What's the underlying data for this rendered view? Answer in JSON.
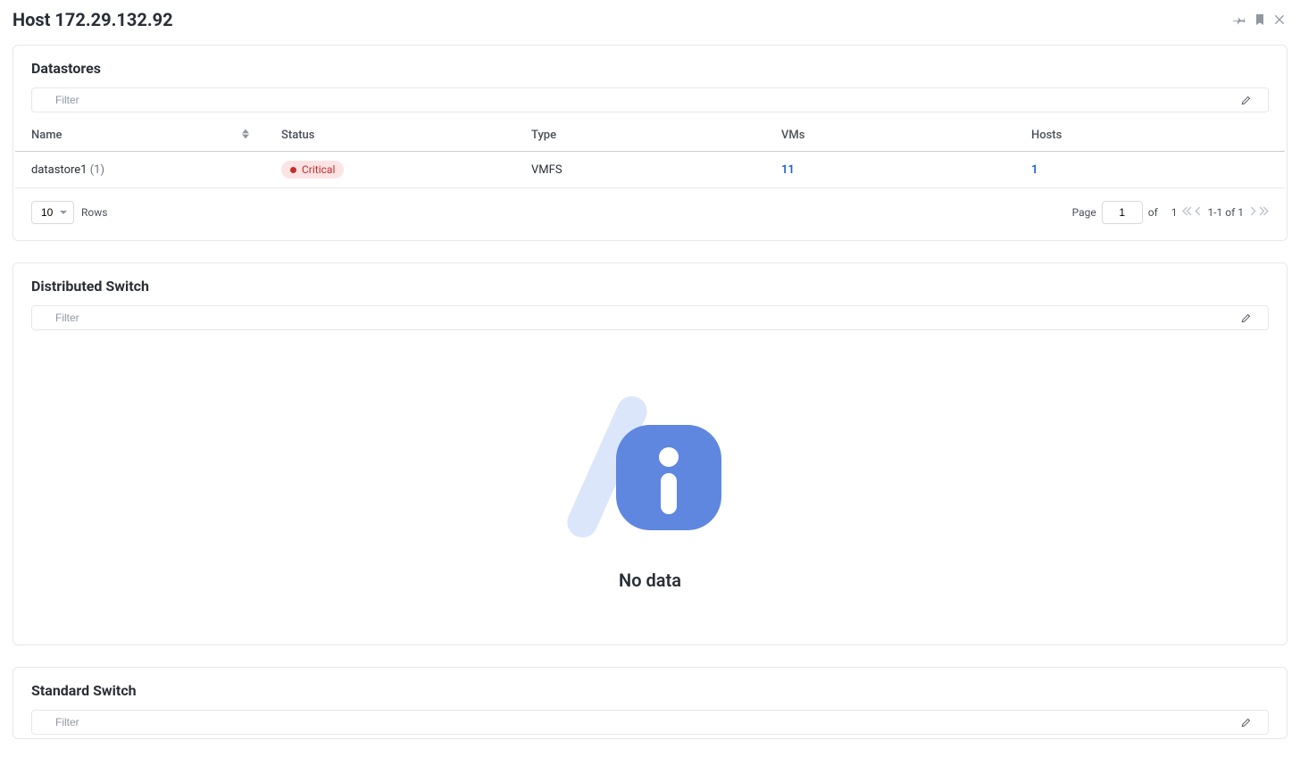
{
  "header": {
    "title": "Host 172.29.132.92"
  },
  "icons": {
    "pin": "pin-icon",
    "bookmark": "bookmark-icon",
    "close": "close-icon"
  },
  "cards": {
    "datastores": {
      "title": "Datastores",
      "filter_placeholder": "Filter",
      "columns": {
        "name": "Name",
        "status": "Status",
        "type": "Type",
        "vms": "VMs",
        "hosts": "Hosts"
      },
      "rows": [
        {
          "name": "datastore1",
          "name_suffix": "(1)",
          "status_label": "Critical",
          "type": "VMFS",
          "vms": "11",
          "hosts": "1"
        }
      ],
      "pagination": {
        "rows_value": "10",
        "rows_label": "Rows",
        "page_label": "Page",
        "page_value": "1",
        "of_label": "of",
        "total_pages": "1",
        "range_text": "1-1 of 1"
      }
    },
    "distSwitch": {
      "title": "Distributed Switch",
      "filter_placeholder": "Filter",
      "empty_text": "No data"
    },
    "stdSwitch": {
      "title": "Standard Switch",
      "filter_placeholder": "Filter"
    }
  }
}
